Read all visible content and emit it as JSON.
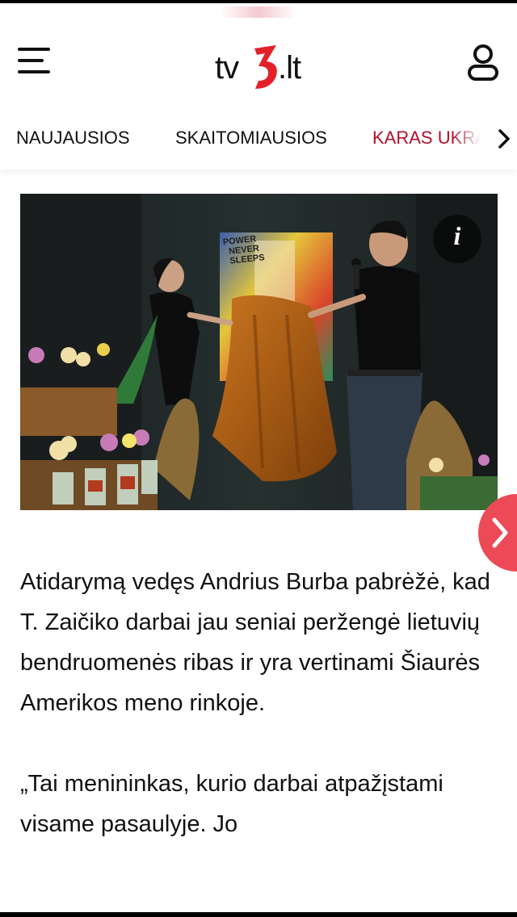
{
  "header": {
    "logo": {
      "prefix": "tv",
      "number": "3",
      "suffix": ".lt"
    },
    "menu_icon": "hamburger-menu-icon",
    "user_icon": "user-profile-icon",
    "brand_color": "#e3212b"
  },
  "nav": {
    "items": [
      {
        "label": "NAUJAUSIOS"
      },
      {
        "label": "SKAITOMIAUSIOS"
      },
      {
        "label": "KARAS UKRA"
      }
    ],
    "active_color": "#b0102a",
    "next_icon": "chevron-right-icon"
  },
  "photo": {
    "painting_text": [
      "POWER",
      "NEVER",
      "SLEEPS"
    ],
    "info_label": "i",
    "next_icon": "chevron-right-icon",
    "next_button_color": "#ed4a57"
  },
  "article": {
    "paragraphs": [
      "Atidarymą vedęs Andrius Burba pabrėžė, kad T. Zaičiko darbai jau seniai peržengė lietuvių bendruomenės ribas ir yra vertinami Šiaurės Amerikos meno rinkoje.",
      "„Tai menininkas, kurio darbai atpažįstami visame pasaulyje. Jo"
    ]
  }
}
